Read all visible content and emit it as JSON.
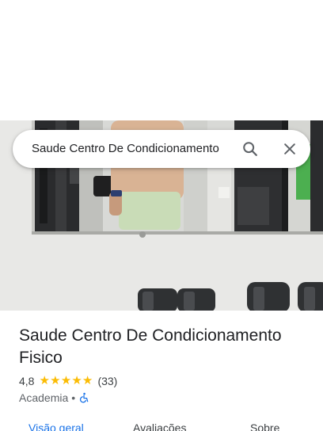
{
  "search": {
    "query": "Saude Centro De Condicionamento"
  },
  "place": {
    "name": "Saude Centro De Condicionamento Fisico",
    "rating": "4,8",
    "stars": [
      "★",
      "★",
      "★",
      "★",
      "★"
    ],
    "review_count": "(33)",
    "category": "Academia",
    "separator": "•"
  },
  "tabs": [
    {
      "label": "Visão geral",
      "active": true
    },
    {
      "label": "Avaliações",
      "active": false
    },
    {
      "label": "Sobre",
      "active": false
    }
  ],
  "icons": {
    "search": "search-icon",
    "close": "close-icon",
    "accessibility": "wheelchair-accessible-icon"
  },
  "colors": {
    "accent": "#1a73e8",
    "star": "#fbbc04",
    "wheelchair": "#1a73e8"
  }
}
